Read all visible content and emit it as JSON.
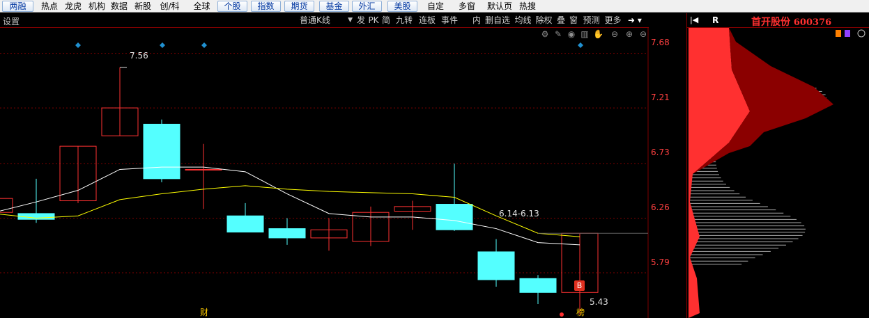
{
  "topnav": {
    "items": [
      {
        "label": "两融",
        "style": "btn"
      },
      {
        "label": "热点",
        "style": "text"
      },
      {
        "label": "龙虎",
        "style": "text"
      },
      {
        "label": "机构",
        "style": "text"
      },
      {
        "label": "数据",
        "style": "text"
      },
      {
        "label": "新股",
        "style": "text"
      },
      {
        "label": "创/科",
        "style": "text"
      },
      {
        "label": "全球",
        "style": "text"
      },
      {
        "label": "个股",
        "style": "btn"
      },
      {
        "label": "指数",
        "style": "btn"
      },
      {
        "label": "期货",
        "style": "btn"
      },
      {
        "label": "基金",
        "style": "btn"
      },
      {
        "label": "外汇",
        "style": "btn"
      },
      {
        "label": "美股",
        "style": "btn"
      },
      {
        "label": "自定",
        "style": "text"
      },
      {
        "label": "多窗",
        "style": "text"
      },
      {
        "label": "默认页",
        "style": "text"
      },
      {
        "label": "热搜",
        "style": "text"
      }
    ]
  },
  "toolbar": {
    "settings": "设置",
    "kline_type": "普通K线",
    "items": [
      "发",
      "PK",
      "简",
      "九转",
      "连板",
      "事件",
      "内",
      "删自选",
      "均线",
      "除权",
      "叠",
      "窗",
      "预测",
      "更多"
    ]
  },
  "right_panel": {
    "stock_name": "首开股份",
    "stock_code": "600376",
    "mode_label": "R"
  },
  "annotations": {
    "high_label": "7.56",
    "low_label": "5.43",
    "range_label": "6.14-6.13",
    "buy_marker": "B",
    "bottom_marker_left": "财",
    "bottom_marker_right": "榜"
  },
  "colors": {
    "up": "#ff3232",
    "down": "#54ffff",
    "ma_white": "#ffffff",
    "ma_yellow": "#ffff00",
    "grid": "#800000",
    "axis_text": "#ff4040",
    "chip_dark": "#8b0000",
    "chip_light": "#ff3030"
  },
  "chart_data": {
    "type": "candlestick",
    "y_ticks": [
      "7.68",
      "7.21",
      "6.73",
      "6.26",
      "5.79"
    ],
    "ylim": [
      5.4,
      7.78
    ],
    "candles": [
      {
        "open": 6.31,
        "close": 6.43,
        "high": 6.46,
        "low": 6.3
      },
      {
        "open": 6.3,
        "close": 6.25,
        "high": 6.6,
        "low": 6.22
      },
      {
        "open": 6.41,
        "close": 6.88,
        "high": 6.88,
        "low": 6.39
      },
      {
        "open": 6.97,
        "close": 7.21,
        "high": 7.56,
        "low": 6.97
      },
      {
        "open": 7.07,
        "close": 6.6,
        "high": 7.11,
        "low": 6.57
      },
      {
        "open": 6.68,
        "close": 6.68,
        "high": 6.9,
        "low": 6.34
      },
      {
        "open": 6.28,
        "close": 6.14,
        "high": 6.39,
        "low": 6.14
      },
      {
        "open": 6.17,
        "close": 6.09,
        "high": 6.26,
        "low": 6.03
      },
      {
        "open": 6.09,
        "close": 6.16,
        "high": 6.26,
        "low": 5.98
      },
      {
        "open": 6.06,
        "close": 6.31,
        "high": 6.36,
        "low": 6.02
      },
      {
        "open": 6.32,
        "close": 6.36,
        "high": 6.41,
        "low": 6.16
      },
      {
        "open": 6.38,
        "close": 6.16,
        "high": 6.73,
        "low": 6.15
      },
      {
        "open": 5.97,
        "close": 5.73,
        "high": 6.08,
        "low": 5.67
      },
      {
        "open": 5.74,
        "close": 5.62,
        "high": 5.77,
        "low": 5.52
      },
      {
        "open": 5.62,
        "close": 6.13,
        "high": 6.13,
        "low": 5.43
      }
    ],
    "ma_white": [
      6.31,
      6.4,
      6.5,
      6.68,
      6.7,
      6.7,
      6.66,
      6.47,
      6.3,
      6.27,
      6.27,
      6.24,
      6.17,
      6.05,
      6.03
    ],
    "ma_yellow": [
      6.3,
      6.26,
      6.28,
      6.42,
      6.47,
      6.51,
      6.54,
      6.51,
      6.49,
      6.48,
      6.47,
      6.44,
      6.28,
      6.13,
      6.1
    ]
  }
}
